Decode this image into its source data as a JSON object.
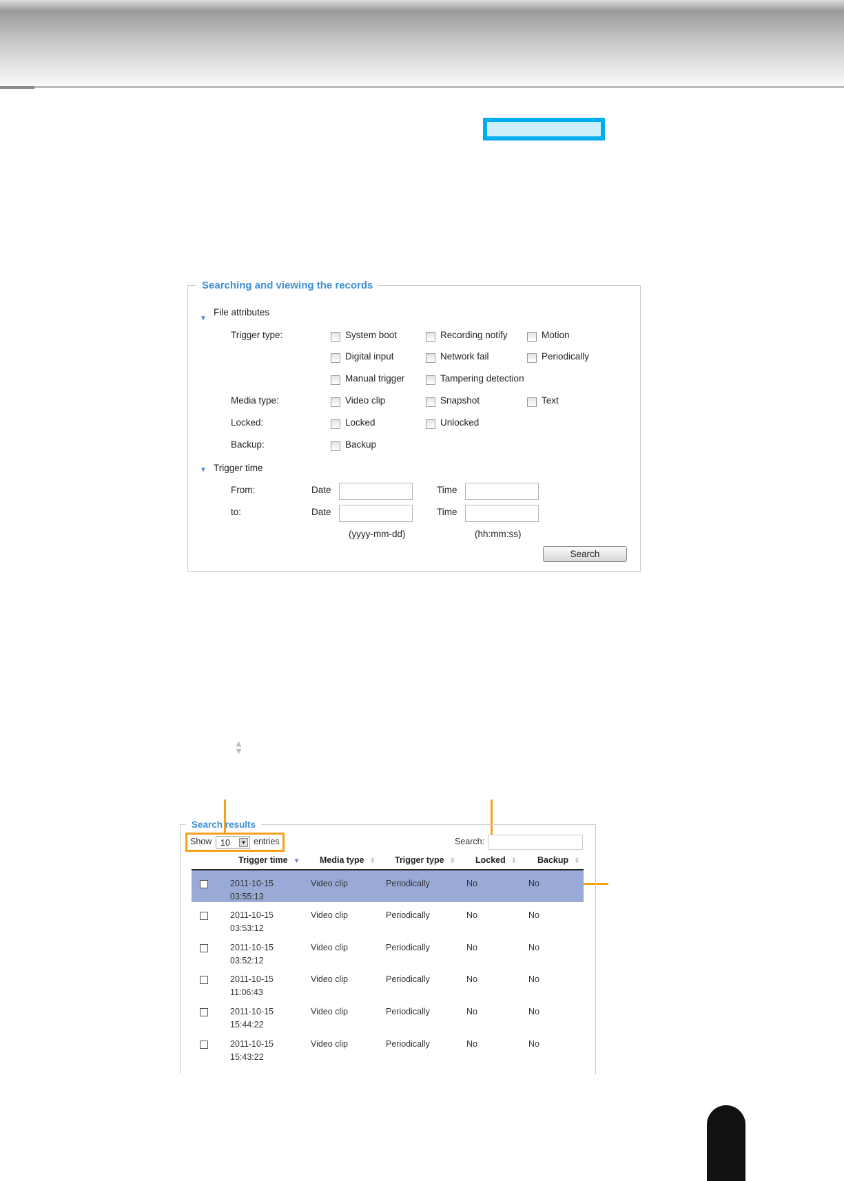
{
  "search_form": {
    "title": "Searching and viewing the records",
    "file_attributes": "File attributes",
    "trigger_type_label": "Trigger type:",
    "trigger_types": [
      "System boot",
      "Recording notify",
      "Motion",
      "Digital input",
      "Network fail",
      "Periodically",
      "Manual trigger",
      "Tampering detection"
    ],
    "media_type_label": "Media type:",
    "media_types": [
      "Video clip",
      "Snapshot",
      "Text"
    ],
    "locked_label": "Locked:",
    "locked_options": [
      "Locked",
      "Unlocked"
    ],
    "backup_label": "Backup:",
    "backup_options": [
      "Backup"
    ],
    "trigger_time": "Trigger time",
    "from_label": "From:",
    "to_label": "to:",
    "date_label": "Date",
    "time_label": "Time",
    "date_hint": "(yyyy-mm-dd)",
    "time_hint": "(hh:mm:ss)",
    "search_button": "Search"
  },
  "results": {
    "title": "Search results",
    "show": "Show",
    "entries_value": "10",
    "entries": "entries",
    "search_label": "Search:",
    "columns": [
      "Trigger time",
      "Media type",
      "Trigger type",
      "Locked",
      "Backup"
    ],
    "rows": [
      {
        "date": "2011-10-15",
        "time": "03:55:13",
        "media": "Video clip",
        "trigger": "Periodically",
        "locked": "No",
        "backup": "No"
      },
      {
        "date": "2011-10-15",
        "time": "03:53:12",
        "media": "Video clip",
        "trigger": "Periodically",
        "locked": "No",
        "backup": "No"
      },
      {
        "date": "2011-10-15",
        "time": "03:52:12",
        "media": "Video clip",
        "trigger": "Periodically",
        "locked": "No",
        "backup": "No"
      },
      {
        "date": "2011-10-15",
        "time": "11:06:43",
        "media": "Video clip",
        "trigger": "Periodically",
        "locked": "No",
        "backup": "No"
      },
      {
        "date": "2011-10-15",
        "time": "15:44:22",
        "media": "Video clip",
        "trigger": "Periodically",
        "locked": "No",
        "backup": "No"
      },
      {
        "date": "2011-10-15",
        "time": "15:43:22",
        "media": "Video clip",
        "trigger": "Periodically",
        "locked": "No",
        "backup": "No"
      }
    ]
  },
  "colors": {
    "accent": "#3d8fd6",
    "callout": "#00aeef",
    "annotation": "#f7a01c",
    "selected_row": "#9aaad6"
  }
}
